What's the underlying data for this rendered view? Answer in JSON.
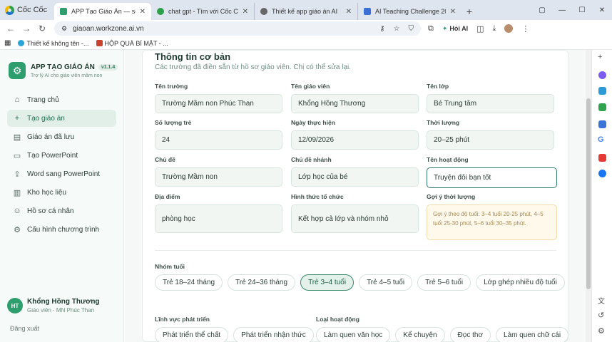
{
  "browser": {
    "brand": "Cốc Cốc",
    "tabs": [
      {
        "title": "APP Tạo Giáo Án — soạn g",
        "favicon_color": "#2f9e6e",
        "active": true
      },
      {
        "title": "chat gpt - Tìm với Cốc Cốc",
        "favicon_color": "#2e9f4a",
        "active": false
      },
      {
        "title": "Thiết kế app giáo án AI",
        "favicon_color": "#666666",
        "active": false
      },
      {
        "title": "AI Teaching Challenge 2026: Ứng",
        "favicon_color": "#3b6fd4",
        "active": false
      }
    ],
    "url": "giaoan.workzone.ai.vn",
    "hoi_ai": "Hỏi AI",
    "bookmarks": [
      {
        "label": "Thiết kế không tên -...",
        "color": "#2aa3d9"
      },
      {
        "label": "HỘP QUÀ BÍ MẬT - ...",
        "color": "#c8442f"
      }
    ]
  },
  "sidebar": {
    "app_title": "APP TẠO GIÁO ÁN",
    "version": "v1.1.4",
    "subtitle": "Trợ lý AI cho giáo viên mầm non",
    "items": [
      {
        "label": "Trang chủ",
        "icon": "home-icon",
        "glyph": "⌂",
        "active": false
      },
      {
        "label": "Tạo giáo án",
        "icon": "plus-icon",
        "glyph": "+",
        "active": true
      },
      {
        "label": "Giáo án đã lưu",
        "icon": "book-icon",
        "glyph": "▤",
        "active": false
      },
      {
        "label": "Tạo PowerPoint",
        "icon": "slides-icon",
        "glyph": "▭",
        "active": false
      },
      {
        "label": "Word sang PowerPoint",
        "icon": "upload-icon",
        "glyph": "⇪",
        "active": false
      },
      {
        "label": "Kho học liệu",
        "icon": "library-icon",
        "glyph": "▥",
        "active": false
      },
      {
        "label": "Hồ sơ cá nhân",
        "icon": "user-icon",
        "glyph": "☺",
        "active": false
      },
      {
        "label": "Cấu hình chương trình",
        "icon": "settings-icon",
        "glyph": "⚙",
        "active": false
      }
    ],
    "user": {
      "initials": "HT",
      "name": "Khổng Hồng Thương",
      "role": "Giáo viên · MN Phúc Than"
    },
    "logout": "Đăng xuất"
  },
  "form": {
    "title": "Thông tin cơ bản",
    "subtitle": "Các trường đã điền sẵn từ hồ sơ giáo viên. Chị có thể sửa lại.",
    "fields": [
      {
        "label": "Tên trường",
        "value": "Trường Mầm non Phúc Than"
      },
      {
        "label": "Tên giáo viên",
        "value": "Khổng Hồng Thương"
      },
      {
        "label": "Tên lớp",
        "value": "Bé Trung tâm"
      },
      {
        "label": "Số lượng trẻ",
        "value": "24"
      },
      {
        "label": "Ngày thực hiện",
        "value": "12/09/2026"
      },
      {
        "label": "Thời lượng",
        "value": "20–25 phút"
      },
      {
        "label": "Chủ đề",
        "value": "Trường Mầm non"
      },
      {
        "label": "Chủ đề nhánh",
        "value": "Lớp học của bé"
      },
      {
        "label": "Tên hoạt động",
        "value": "Truyện đôi bạn tốt"
      },
      {
        "label": "Địa điểm",
        "value": "phòng học"
      },
      {
        "label": "Hình thức tổ chức",
        "value": "Kết hợp cả lớp và nhóm nhỏ"
      }
    ],
    "duration_hint": {
      "label": "Gợi ý thời lượng",
      "text": "Gợi ý theo độ tuổi: 3–4 tuổi 20-25 phút, 4–5 tuổi 25-30 phút, 5–6 tuổi 30–35 phút."
    },
    "age_group": {
      "label": "Nhóm tuổi",
      "options": [
        "Trẻ 18–24 tháng",
        "Trẻ 24–36 tháng",
        "Trẻ 3–4 tuổi",
        "Trẻ 4–5 tuổi",
        "Trẻ 5–6 tuổi",
        "Lớp ghép nhiều độ tuổi"
      ],
      "selected": "Trẻ 3–4 tuổi"
    },
    "domain": {
      "label": "Lĩnh vực phát triển",
      "options": [
        "Phát triển thể chất",
        "Phát triển nhận thức"
      ]
    },
    "activity_type": {
      "label": "Loại hoạt động",
      "options": [
        "Làm quen văn học",
        "Kể chuyện",
        "Đọc thơ",
        "Làm quen chữ cái"
      ]
    }
  },
  "colors": {
    "accent": "#2f9e6e",
    "selected_chip_border": "#3b8a6a",
    "hint_bg": "#fff9ec"
  }
}
